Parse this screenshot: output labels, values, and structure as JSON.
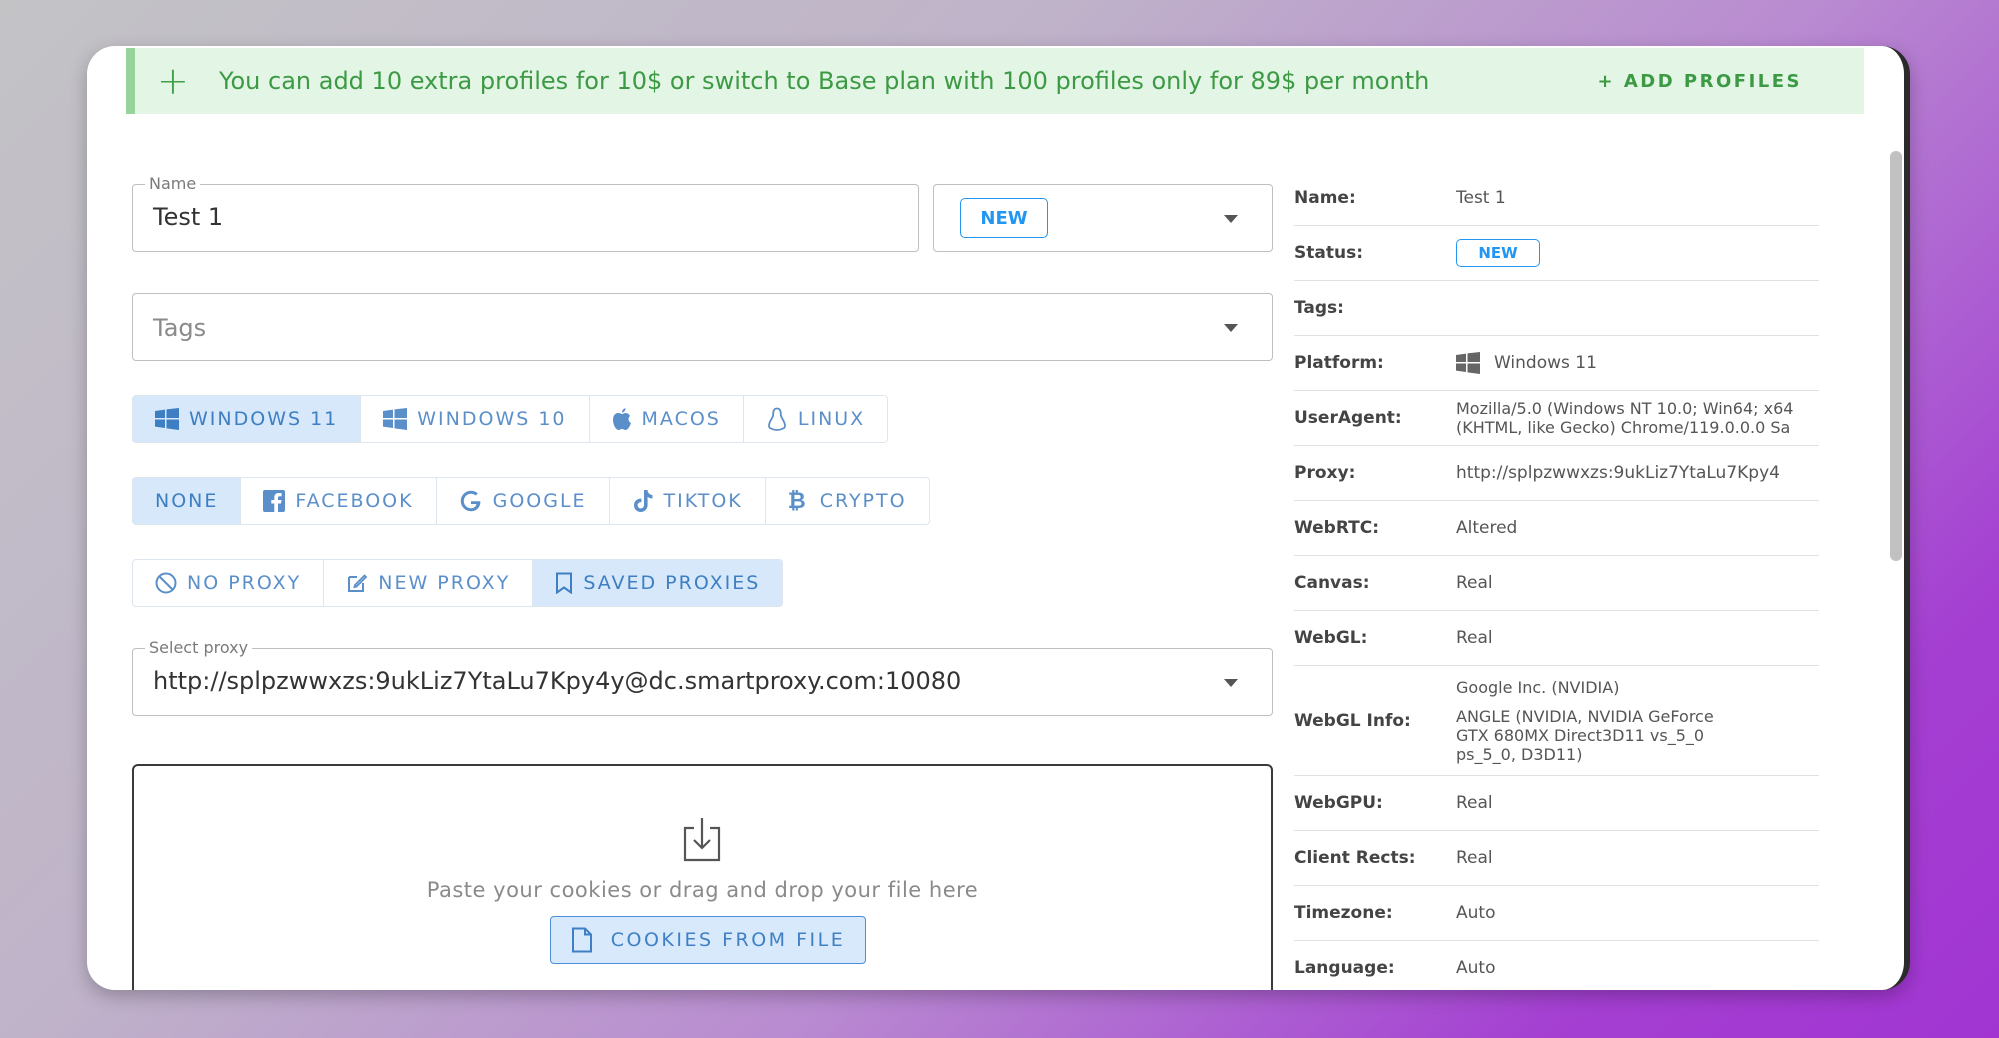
{
  "banner": {
    "plus": "+",
    "message": "You can add 10 extra profiles for 10$ or switch to Base plan with 100 profiles only for 89$ per month",
    "action": "+ ADD PROFILES"
  },
  "form": {
    "name_label": "Name",
    "name_value": "Test 1",
    "status_value": "NEW",
    "tags_placeholder": "Tags",
    "os_options": [
      {
        "label": "WINDOWS 11",
        "icon": "windows-icon",
        "active": true
      },
      {
        "label": "WINDOWS 10",
        "icon": "windows-icon",
        "active": false
      },
      {
        "label": "MACOS",
        "icon": "apple-icon",
        "active": false
      },
      {
        "label": "LINUX",
        "icon": "linux-icon",
        "active": false
      }
    ],
    "template_options": [
      {
        "label": "NONE",
        "active": true
      },
      {
        "label": "FACEBOOK",
        "icon": "facebook-icon",
        "active": false
      },
      {
        "label": "GOOGLE",
        "icon": "google-icon",
        "active": false
      },
      {
        "label": "TIKTOK",
        "icon": "tiktok-icon",
        "active": false
      },
      {
        "label": "CRYPTO",
        "icon": "bitcoin-icon",
        "active": false
      }
    ],
    "proxy_options": [
      {
        "label": "NO PROXY",
        "icon": "no-entry-icon",
        "active": false
      },
      {
        "label": "NEW PROXY",
        "icon": "edit-icon",
        "active": false
      },
      {
        "label": "SAVED PROXIES",
        "icon": "bookmark-icon",
        "active": true
      }
    ],
    "select_proxy_label": "Select proxy",
    "select_proxy_value": "http://splpzwwxzs:9ukLiz7YtaLu7Kpy4y@dc.smartproxy.com:10080",
    "cookies_hint": "Paste your cookies or drag and drop your file here",
    "cookies_button": "COOKIES FROM FILE"
  },
  "info": {
    "name_key": "Name:",
    "name_val": "Test 1",
    "status_key": "Status:",
    "status_val": "NEW",
    "tags_key": "Tags:",
    "platform_key": "Platform:",
    "platform_val": "Windows 11",
    "ua_key": "UserAgent:",
    "ua_line1": "Mozilla/5.0 (Windows NT 10.0; Win64; x64",
    "ua_line2": "(KHTML, like Gecko) Chrome/119.0.0.0 Sa",
    "proxy_key": "Proxy:",
    "proxy_val": "http://splpzwwxzs:9ukLiz7YtaLu7Kpy4",
    "webrtc_key": "WebRTC:",
    "webrtc_val": "Altered",
    "canvas_key": "Canvas:",
    "canvas_val": "Real",
    "webgl_key": "WebGL:",
    "webgl_val": "Real",
    "webglinfo_key": "WebGL Info:",
    "webglinfo_vendor": "Google Inc. (NVIDIA)",
    "webglinfo_r1": "ANGLE (NVIDIA, NVIDIA GeForce",
    "webglinfo_r2": "GTX 680MX Direct3D11 vs_5_0",
    "webglinfo_r3": "ps_5_0, D3D11)",
    "webgpu_key": "WebGPU:",
    "webgpu_val": "Real",
    "rects_key": "Client Rects:",
    "rects_val": "Real",
    "tz_key": "Timezone:",
    "tz_val": "Auto",
    "lang_key": "Language:",
    "lang_val": "Auto"
  },
  "colors": {
    "accent": "#2196f3",
    "banner_bg": "#e3f5e4",
    "banner_text": "#3c9a44"
  }
}
